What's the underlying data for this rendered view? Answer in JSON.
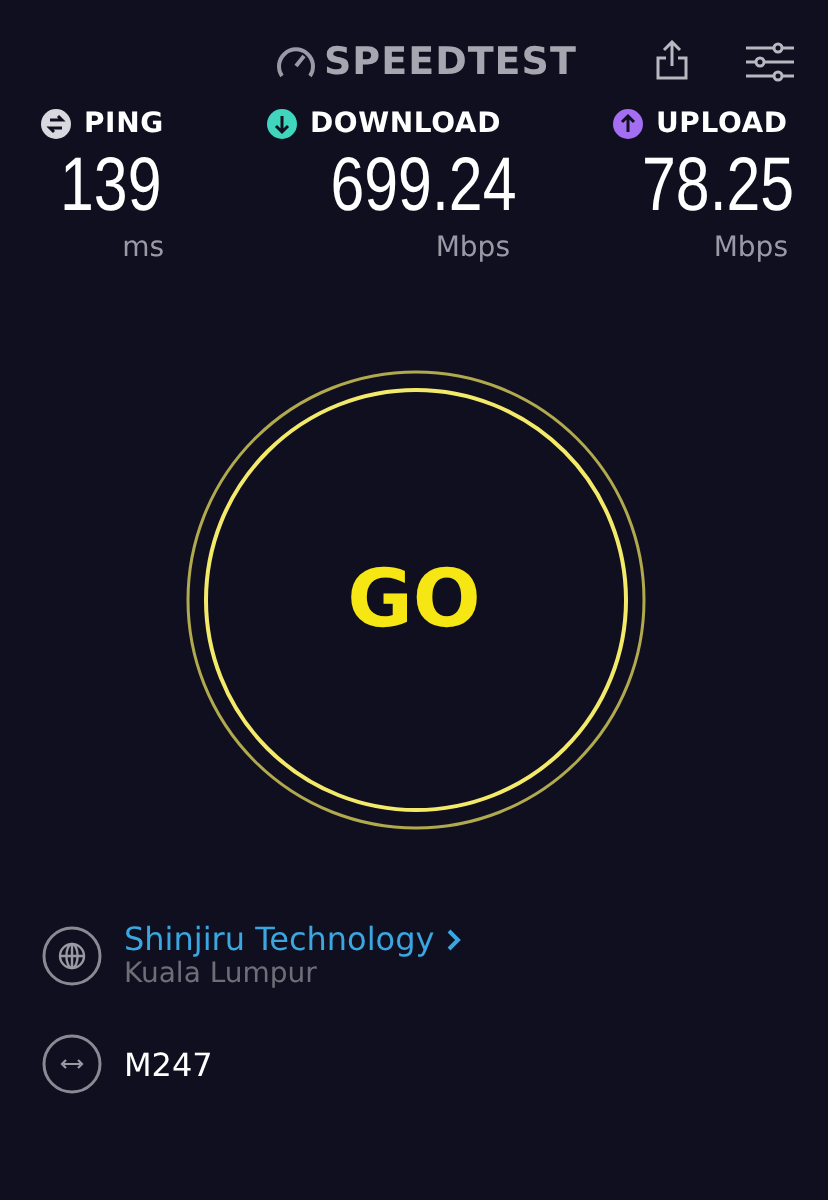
{
  "header": {
    "logo": "SPEEDTEST"
  },
  "metrics": [
    {
      "kind": "ping",
      "label": "PING",
      "value": "139",
      "unit": "ms",
      "color": "#d8d8de"
    },
    {
      "kind": "download",
      "label": "DOWNLOAD",
      "value": "699.24",
      "unit": "Mbps",
      "color": "#3fd6bd"
    },
    {
      "kind": "upload",
      "label": "UPLOAD",
      "value": "78.25",
      "unit": "Mbps",
      "color": "#a46ef2"
    }
  ],
  "go_button": {
    "label": "GO"
  },
  "server": {
    "name": "Shinjiru Technology",
    "location": "Kuala Lumpur"
  },
  "isp": {
    "name": "M247"
  }
}
